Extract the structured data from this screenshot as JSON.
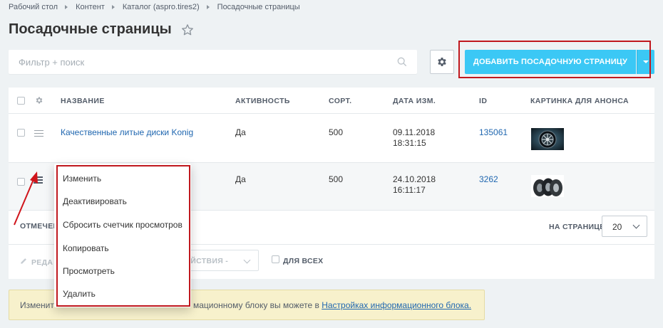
{
  "breadcrumb": [
    "Рабочий стол",
    "Контент",
    "Каталог (aspro.tires2)",
    "Посадочные страницы"
  ],
  "page_title": "Посадочные страницы",
  "search": {
    "placeholder": "Фильтр + поиск"
  },
  "toolbar": {
    "add_button_label": "ДОБАВИТЬ ПОСАДОЧНУЮ СТРАНИЦУ"
  },
  "table": {
    "headers": [
      "НАЗВАНИЕ",
      "АКТИВНОСТЬ",
      "СОРТ.",
      "ДАТА ИЗМ.",
      "ID",
      "КАРТИНКА ДЛЯ АНОНСА"
    ],
    "rows": [
      {
        "name": "Качественные литые диски Konig",
        "active": "Да",
        "sort": "500",
        "date": "09.11.2018",
        "time": "18:31:15",
        "id": "135061",
        "image": "alloy-wheel-thumbnail"
      },
      {
        "name": "",
        "active": "Да",
        "sort": "500",
        "date": "24.10.2018",
        "time": "16:11:17",
        "id": "3262",
        "image": "tires-thumbnail"
      }
    ]
  },
  "footer": {
    "selected_label": "ОТМЕЧЕН",
    "per_page_label": "НА СТРАНИЦЕ:",
    "per_page_value": "20"
  },
  "action_bar": {
    "edit_label": "РЕДА",
    "actions_label": "ЕЙСТВИЯ -",
    "for_all_label": "ДЛЯ ВСЕХ"
  },
  "notice": {
    "text_start": "Изменит",
    "text_end": "мационному блоку вы можете в",
    "link": "Настройках информационного блока."
  },
  "context_menu": {
    "items": [
      "Изменить",
      "Деактивировать",
      "Сбросить счетчик просмотров",
      "Копировать",
      "Просмотреть",
      "Удалить"
    ]
  },
  "colors": {
    "accent": "#3bc8f5",
    "link": "#2067b0",
    "highlight": "#c0181e",
    "notice_bg": "#f7f1cc"
  }
}
